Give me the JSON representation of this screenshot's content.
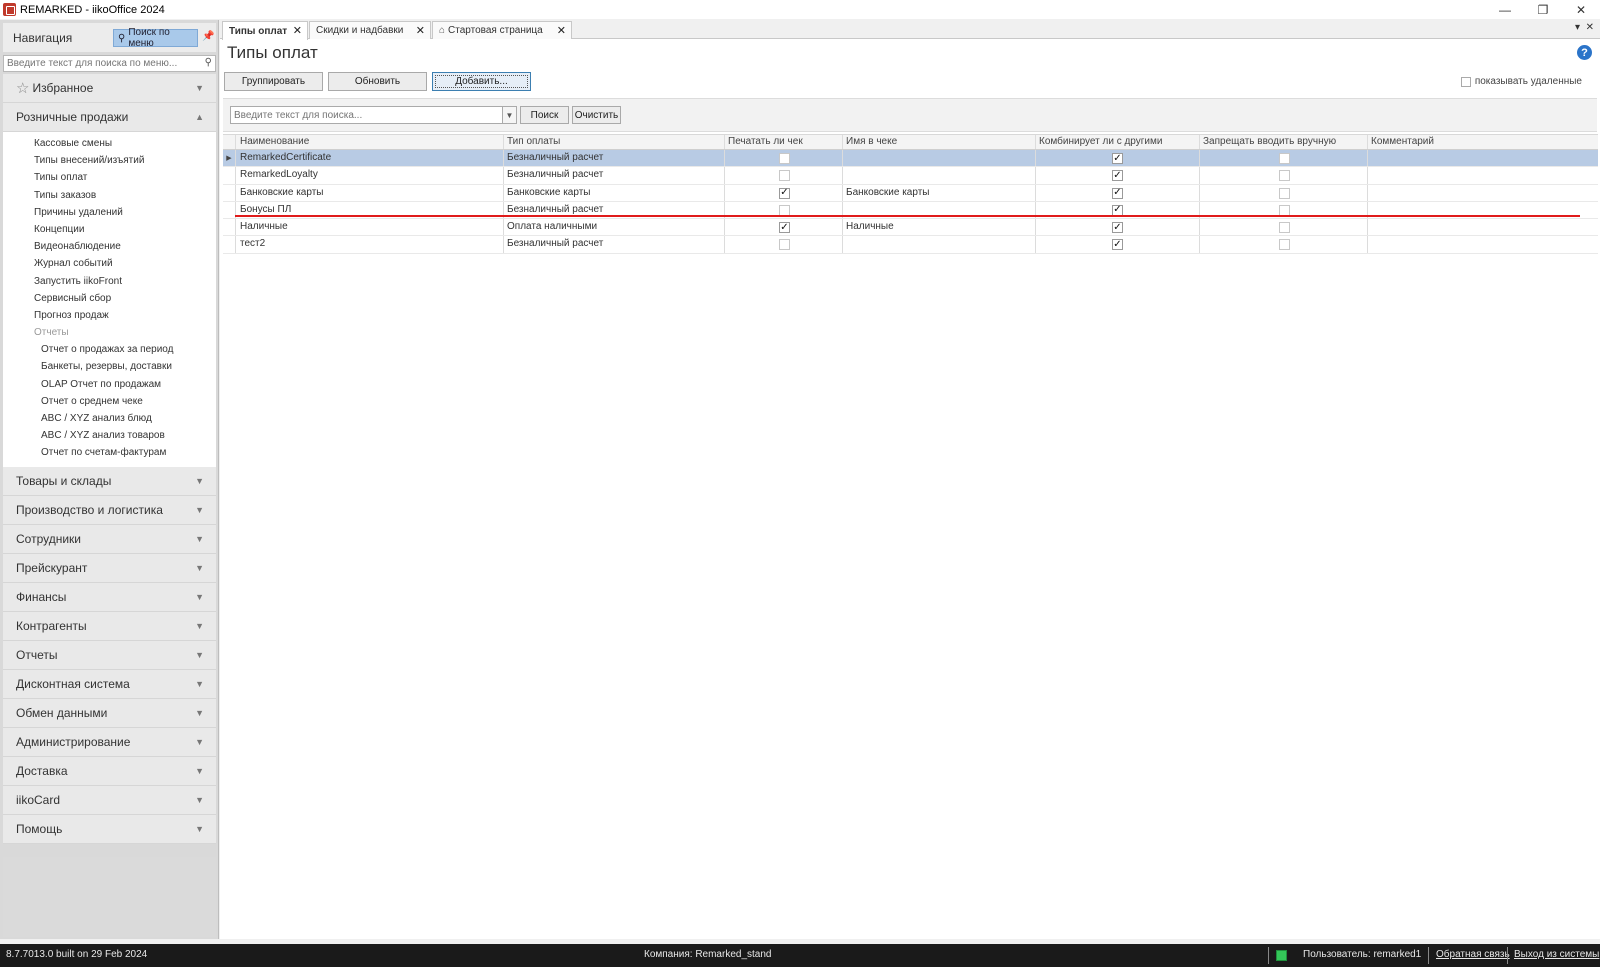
{
  "window": {
    "title": "REMARKED - iikoOffice 2024",
    "controls": {
      "minimize": "—",
      "restore": "❐",
      "close": "✕"
    }
  },
  "nav": {
    "title": "Навигация",
    "search_menu_button": "Поиск по меню",
    "search_placeholder": "Введите текст для поиска по меню...",
    "favorites": "Избранное",
    "expanded_section": "Розничные продажи",
    "retail_items": [
      "Кассовые смены",
      "Типы внесений/изъятий",
      "Типы оплат",
      "Типы заказов",
      "Причины удалений",
      "Концепции",
      "Видеонаблюдение",
      "Журнал событий",
      "Запустить iikoFront",
      "Сервисный сбор",
      "Прогноз продаж"
    ],
    "reports_group": "Отчеты",
    "report_items": [
      "Отчет о продажах за период",
      "Банкеты, резервы, доставки",
      "OLAP Отчет по продажам",
      "Отчет о среднем чеке",
      "ABC / XYZ анализ блюд",
      "ABC / XYZ анализ товаров",
      "Отчет по счетам-фактурам"
    ],
    "sections": [
      "Товары и склады",
      "Производство и логистика",
      "Сотрудники",
      "Прейскурант",
      "Финансы",
      "Контрагенты",
      "Отчеты",
      "Дисконтная система",
      "Обмен данными",
      "Администрирование",
      "Доставка",
      "iikoCard",
      "Помощь"
    ]
  },
  "tabs": [
    {
      "label": "Типы оплат",
      "active": true
    },
    {
      "label": "Скидки и надбавки",
      "active": false
    },
    {
      "label": "Стартовая страница",
      "active": false
    }
  ],
  "page": {
    "title": "Типы оплат",
    "help": "?",
    "buttons": {
      "group": "Группировать",
      "refresh": "Обновить",
      "add": "Добавить..."
    },
    "show_deleted": "показывать удаленные"
  },
  "filter": {
    "placeholder": "Введите текст для поиска...",
    "search_button": "Поиск",
    "clear_button": "Очистить"
  },
  "grid": {
    "columns": [
      "Наименование",
      "Тип оплаты",
      "Печатать ли чек",
      "Имя в чеке",
      "Комбинирует ли с другими",
      "Запрещать вводить вручную",
      "Комментарий"
    ],
    "rows": [
      {
        "name": "RemarkedCertificate",
        "type": "Безналичный расчет",
        "print": false,
        "receipt_name": "",
        "combine": true,
        "forbid_manual": false,
        "comment": ""
      },
      {
        "name": "RemarkedLoyalty",
        "type": "Безналичный расчет",
        "print": false,
        "receipt_name": "",
        "combine": true,
        "forbid_manual": false,
        "comment": ""
      },
      {
        "name": "Банковские карты",
        "type": "Банковские карты",
        "print": true,
        "receipt_name": "Банковские карты",
        "combine": true,
        "forbid_manual": false,
        "comment": ""
      },
      {
        "name": "Бонусы ПЛ",
        "type": "Безналичный расчет",
        "print": false,
        "receipt_name": "",
        "combine": true,
        "forbid_manual": false,
        "comment": ""
      },
      {
        "name": "Наличные",
        "type": "Оплата наличными",
        "print": true,
        "receipt_name": "Наличные",
        "combine": true,
        "forbid_manual": false,
        "comment": ""
      },
      {
        "name": "тест2",
        "type": "Безналичный расчет",
        "print": false,
        "receipt_name": "",
        "combine": true,
        "forbid_manual": false,
        "comment": ""
      }
    ],
    "selected_row": 0
  },
  "status": {
    "version": "8.7.7013.0 built on 29 Feb 2024",
    "company": "Компания: Remarked_stand",
    "users": "Пользователь: remarked1",
    "feedback": "Обратная связь",
    "logout": "Выход из системы"
  },
  "colors": {
    "selection": "#b8cbe4",
    "annotation_line": "#e01b1b",
    "statusbar": "#1a1a1a",
    "status_ok": "#34c759"
  }
}
